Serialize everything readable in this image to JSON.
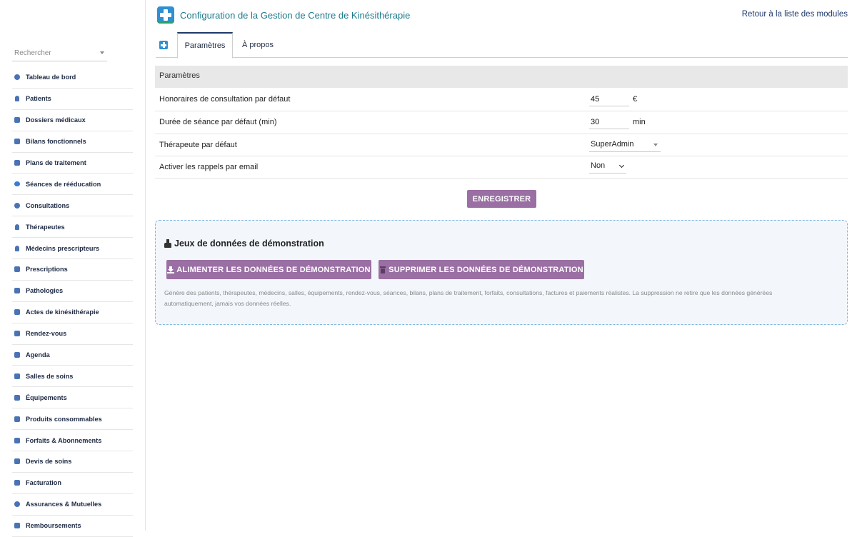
{
  "header": {
    "title": "Configuration de la Gestion de Centre de Kinésithérapie",
    "back_link": "Retour à la liste des modules"
  },
  "sidebar": {
    "search_placeholder": "Rechercher",
    "items": [
      {
        "label": "Tableau de bord",
        "icon": "dashboard-icon"
      },
      {
        "label": "Patients",
        "icon": "user-icon"
      },
      {
        "label": "Dossiers médicaux",
        "icon": "folder-icon"
      },
      {
        "label": "Bilans fonctionnels",
        "icon": "clipboard-icon"
      },
      {
        "label": "Plans de traitement",
        "icon": "clipboard-plan-icon"
      },
      {
        "label": "Séances de rééducation",
        "icon": "heart-icon"
      },
      {
        "label": "Consultations",
        "icon": "stethoscope-icon"
      },
      {
        "label": "Thérapeutes",
        "icon": "user-md-icon"
      },
      {
        "label": "Médecins prescripteurs",
        "icon": "user-doctor-icon"
      },
      {
        "label": "Prescriptions",
        "icon": "prescription-icon"
      },
      {
        "label": "Pathologies",
        "icon": "disease-icon"
      },
      {
        "label": "Actes de kinésithérapie",
        "icon": "hands-icon"
      },
      {
        "label": "Rendez-vous",
        "icon": "calendar-check-icon"
      },
      {
        "label": "Agenda",
        "icon": "calendar-icon"
      },
      {
        "label": "Salles de soins",
        "icon": "door-icon"
      },
      {
        "label": "Équipements",
        "icon": "medkit-icon"
      },
      {
        "label": "Produits consommables",
        "icon": "boxes-icon"
      },
      {
        "label": "Forfaits & Abonnements",
        "icon": "card-icon"
      },
      {
        "label": "Devis de soins",
        "icon": "file-signature-icon"
      },
      {
        "label": "Facturation",
        "icon": "invoice-icon"
      },
      {
        "label": "Assurances & Mutuelles",
        "icon": "shield-icon"
      },
      {
        "label": "Remboursements",
        "icon": "refund-icon"
      }
    ]
  },
  "tabs": [
    {
      "label": "Paramètres",
      "active": true
    },
    {
      "label": "À propos",
      "active": false
    }
  ],
  "params": {
    "section_title": "Paramètres",
    "rows": [
      {
        "label": "Honoraires de consultation par défaut",
        "value": "45",
        "unit": "€"
      },
      {
        "label": "Durée de séance par défaut (min)",
        "value": "30",
        "unit": "min"
      },
      {
        "label": "Thérapeute par défaut",
        "value": "SuperAdmin"
      },
      {
        "label": "Activer les rappels par email",
        "value": "Non"
      }
    ],
    "save_label": "ENREGISTRER"
  },
  "demo": {
    "title": "Jeux de données de démonstration",
    "feed_label": "ALIMENTER LES DONNÉES DE DÉMONSTRATION",
    "delete_label": "SUPPRIMER LES DONNÉES DE DÉMONSTRATION",
    "description": "Génère des patients, thérapeutes, médecins, salles, équipements, rendez-vous, séances, bilans, plans de traitement, forfaits, consultations, factures et paiements réalistes. La suppression ne retire que les données générées automatiquement, jamais vos données réelles."
  },
  "colors": {
    "accent_button": "#9a6fa3",
    "title_teal": "#1a7a8c",
    "sidebar_icon": "#4a73b5",
    "demo_border": "#7eb8e0"
  }
}
